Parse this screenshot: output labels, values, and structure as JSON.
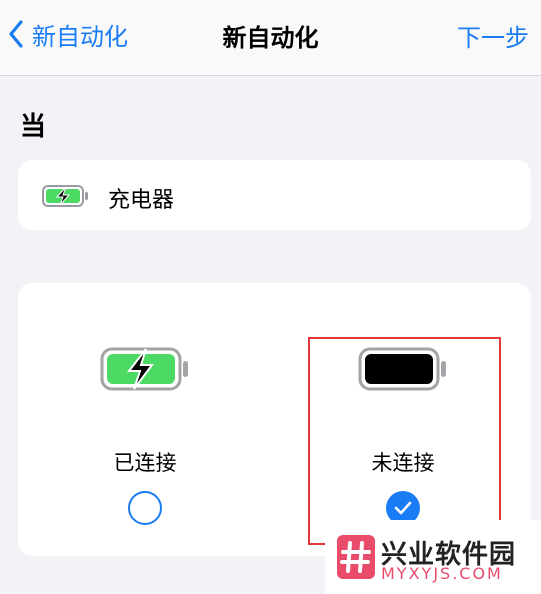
{
  "nav": {
    "back_label": "新自动化",
    "title": "新自动化",
    "next_label": "下一步"
  },
  "section": {
    "title": "当"
  },
  "trigger": {
    "label": "充电器",
    "icon": "battery-charging-icon"
  },
  "options": [
    {
      "label": "已连接",
      "icon": "battery-charging-icon",
      "selected": false
    },
    {
      "label": "未连接",
      "icon": "battery-full-black-icon",
      "selected": true
    }
  ],
  "watermark": {
    "title": "兴业软件园",
    "url": "MYXYJS.COM"
  },
  "colors": {
    "accent": "#1a7cf5",
    "battery_green": "#4cd964",
    "highlight": "#e03a3a",
    "watermark_pink": "#e94b6b"
  }
}
